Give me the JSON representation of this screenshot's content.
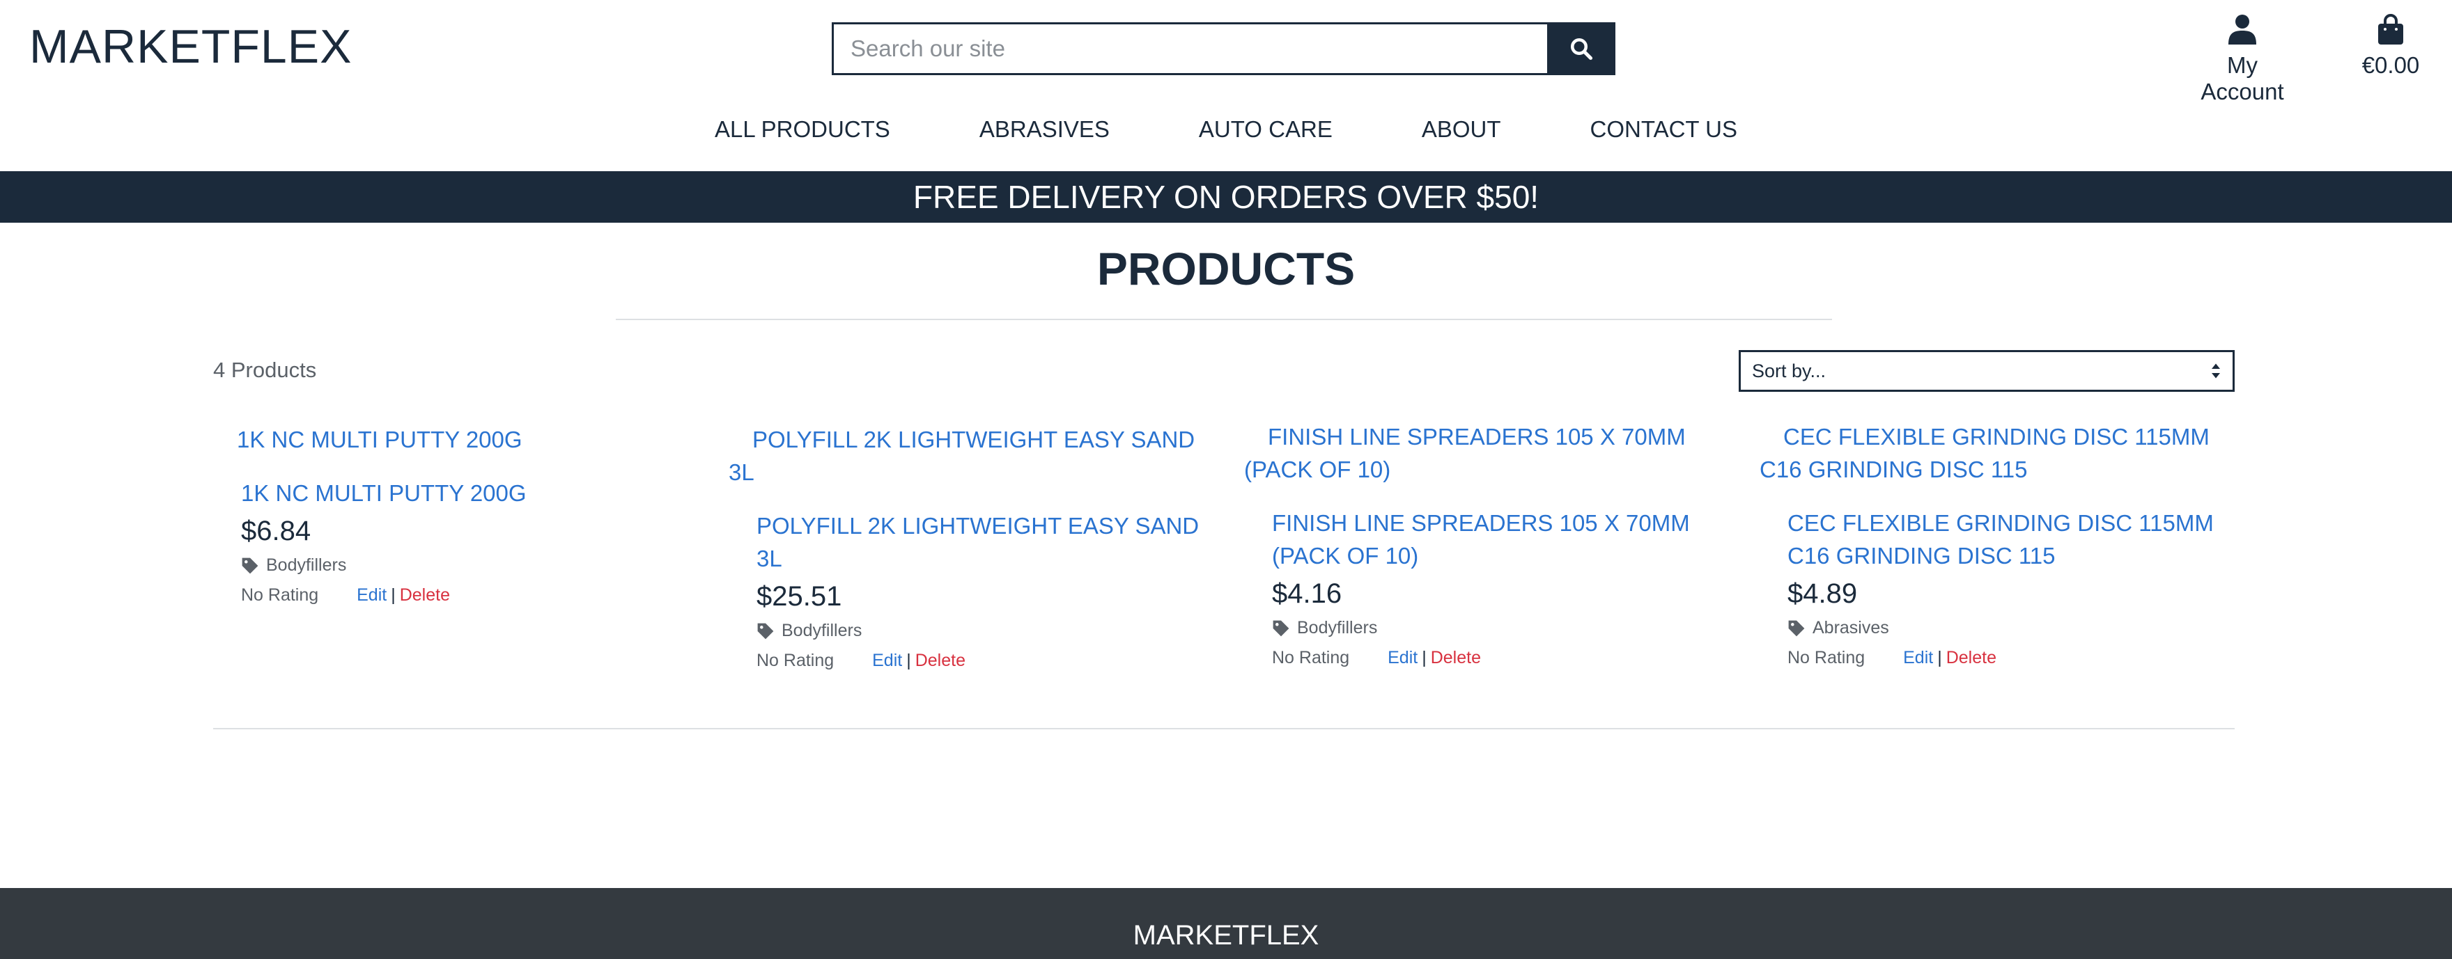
{
  "header": {
    "logo": "MARKETFLEX",
    "search": {
      "placeholder": "Search our site",
      "value": ""
    },
    "account_label": "My Account",
    "cart_total": "€0.00"
  },
  "nav": {
    "items": [
      {
        "label": "ALL PRODUCTS"
      },
      {
        "label": "ABRASIVES"
      },
      {
        "label": "AUTO CARE"
      },
      {
        "label": "ABOUT"
      },
      {
        "label": "CONTACT US"
      }
    ]
  },
  "banner": {
    "text": "FREE DELIVERY ON ORDERS OVER $50!"
  },
  "main": {
    "title": "PRODUCTS",
    "count": "4 Products",
    "sort_label": "Sort by...",
    "products": [
      {
        "image_alt": "1K NC MULTI PUTTY 200G",
        "name": "1K NC MULTI PUTTY 200G",
        "price": "$6.84",
        "category": "Bodyfillers",
        "rating": "No Rating",
        "edit": "Edit",
        "sep": "|",
        "delete": "Delete"
      },
      {
        "image_alt": "POLYFILL 2K LIGHTWEIGHT EASY SAND 3L",
        "name": "POLYFILL 2K LIGHTWEIGHT EASY SAND 3L",
        "price": "$25.51",
        "category": "Bodyfillers",
        "rating": "No Rating",
        "edit": "Edit",
        "sep": "|",
        "delete": "Delete"
      },
      {
        "image_alt": "FINISH LINE SPREADERS 105 X 70MM (PACK OF 10)",
        "name": "FINISH LINE SPREADERS 105 X 70MM (PACK OF 10)",
        "price": "$4.16",
        "category": "Bodyfillers",
        "rating": "No Rating",
        "edit": "Edit",
        "sep": "|",
        "delete": "Delete"
      },
      {
        "image_alt": "CEC FLEXIBLE GRINDING DISC 115MM C16 GRINDING DISC 115",
        "name": "CEC FLEXIBLE GRINDING DISC 115MM C16 GRINDING DISC 115",
        "price": "$4.89",
        "category": "Abrasives",
        "rating": "No Rating",
        "edit": "Edit",
        "sep": "|",
        "delete": "Delete"
      }
    ]
  },
  "footer": {
    "title": "MARKETFLEX"
  },
  "colors": {
    "navy": "#1b2a3b",
    "link": "#2a73d0",
    "danger": "#d8313f",
    "footer_bg": "#343a40"
  },
  "icons": {
    "search": "search-icon",
    "account": "user-icon",
    "cart": "shopping-bag-icon",
    "tag": "tag-icon",
    "sort": "sort-arrows-icon"
  }
}
